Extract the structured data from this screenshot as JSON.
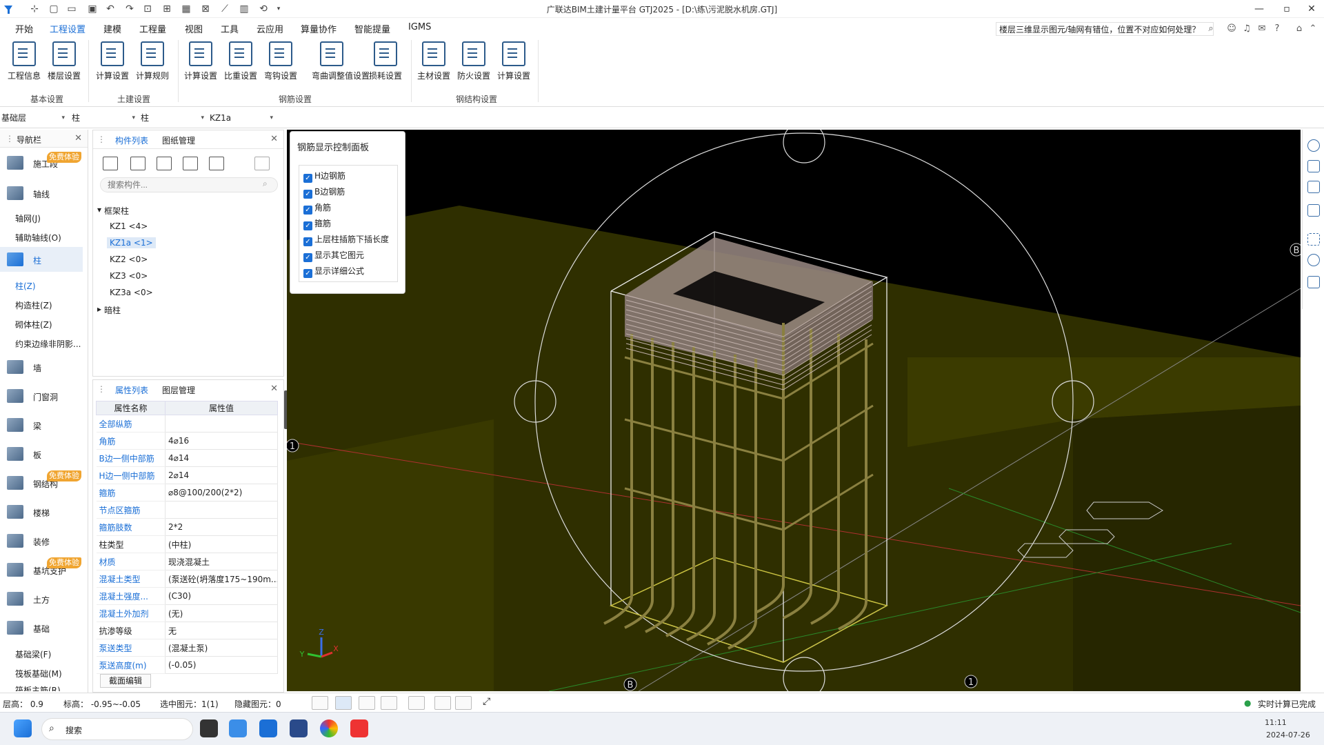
{
  "window": {
    "title": "广联达BIM土建计量平台 GTJ2025 - [D:\\练\\污泥脱水机房.GTJ]",
    "minimize": "—",
    "restore": "▫",
    "close": "✕"
  },
  "menu": [
    "开始",
    "工程设置",
    "建模",
    "工程量",
    "视图",
    "工具",
    "云应用",
    "算量协作",
    "智能提量",
    "IGMS"
  ],
  "menu_active": "工程设置",
  "help_search": {
    "value": "楼层三维显示图元/轴网有错位，位置不对应如何处理？"
  },
  "ribbon": {
    "buttons": [
      "工程信息",
      "楼层设置",
      "计算设置",
      "计算规则",
      "计算设置",
      "比重设置",
      "弯钩设置",
      "弯曲调整值设置",
      "损耗设置",
      "主材设置",
      "防火设置",
      "计算设置"
    ],
    "groups": [
      "基本设置",
      "土建设置",
      "钢筋设置",
      "钢结构设置"
    ]
  },
  "dropdowns": [
    "基础层",
    "柱",
    "柱",
    "KZ1a"
  ],
  "nav": {
    "title": "导航栏",
    "badge": "免费体验",
    "items": [
      "施工段",
      "轴线",
      "柱",
      "墙",
      "门窗洞",
      "梁",
      "板",
      "钢结构",
      "楼梯",
      "装修",
      "基坑支护",
      "土方",
      "基础"
    ],
    "axis_sub": [
      "轴网(J)",
      "辅助轴线(O)"
    ],
    "column_sub": [
      "柱(Z)",
      "构造柱(Z)",
      "砌体柱(Z)",
      "约束边缘非阴影..."
    ],
    "foundation_sub": [
      "基础梁(F)",
      "筏板基础(M)",
      "筏板主筋(R)"
    ]
  },
  "component_panel": {
    "tabs": [
      "构件列表",
      "图纸管理"
    ],
    "search_placeholder": "搜索构件...",
    "tree_group1": "框架柱",
    "items": [
      "KZ1 <4>",
      "KZ1a <1>",
      "KZ2 <0>",
      "KZ3 <0>",
      "KZ3a <0>"
    ],
    "tree_group2": "暗柱"
  },
  "property_panel": {
    "tabs": [
      "属性列表",
      "图层管理"
    ],
    "headers": [
      "属性名称",
      "属性值"
    ],
    "rows": [
      {
        "name": "全部纵筋",
        "value": ""
      },
      {
        "name": "角筋",
        "value": "4⌀16"
      },
      {
        "name": "B边一侧中部筋",
        "value": "4⌀14"
      },
      {
        "name": "H边一侧中部筋",
        "value": "2⌀14"
      },
      {
        "name": "箍筋",
        "value": "⌀8@100/200(2*2)"
      },
      {
        "name": "节点区箍筋",
        "value": ""
      },
      {
        "name": "箍筋肢数",
        "value": "2*2"
      },
      {
        "name": "柱类型",
        "value": "(中柱)"
      },
      {
        "name": "材质",
        "value": "现浇混凝土"
      },
      {
        "name": "混凝土类型",
        "value": "(泵送砼(坍落度175~190m..."
      },
      {
        "name": "混凝土强度...",
        "value": "(C30)"
      },
      {
        "name": "混凝土外加剂",
        "value": "(无)"
      },
      {
        "name": "抗渗等级",
        "value": "无"
      },
      {
        "name": "泵送类型",
        "value": "(混凝土泵)"
      },
      {
        "name": "泵送高度(m)",
        "value": "(-0.05)"
      }
    ],
    "section_edit": "截面编辑"
  },
  "rebar_panel": {
    "title": "钢筋显示控制面板",
    "options": [
      "H边钢筋",
      "B边钢筋",
      "角筋",
      "箍筋",
      "上层柱插筋下插长度",
      "显示其它图元",
      "显示详细公式"
    ]
  },
  "viewport": {
    "axis_labels": [
      "1",
      "B",
      "B",
      "1"
    ],
    "gizmo": [
      "Z",
      "Y",
      "X"
    ]
  },
  "status": {
    "floor_height": "层高：  0.9",
    "elevation": "标高：  -0.95~-0.05",
    "selected": "选中图元：1(1)",
    "hidden": "隐藏图元：0",
    "realtime": "实时计算已完成"
  },
  "taskbar": {
    "search": "搜索",
    "time": "11:11",
    "date": "2024-07-26"
  },
  "colors": {
    "accent": "#1b6fd6",
    "badge": "#f0a531",
    "viewport_bg": "#000000",
    "soil": "#3b3b00"
  }
}
